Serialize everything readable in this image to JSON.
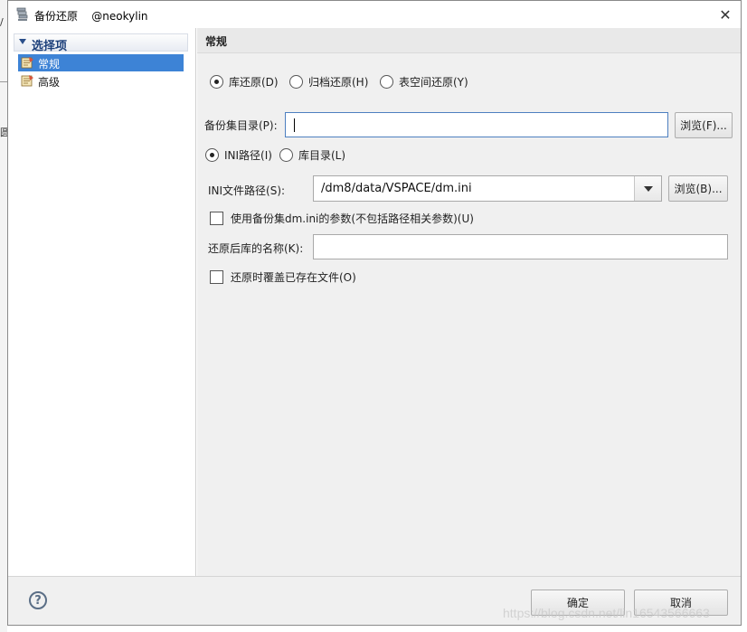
{
  "window": {
    "title": "备份还原",
    "subtitle": "@neokylin",
    "close_glyph": "✕"
  },
  "tree": {
    "header": "选择项",
    "items": [
      {
        "label": "常规",
        "selected": true
      },
      {
        "label": "高级",
        "selected": false
      }
    ]
  },
  "section": {
    "title": "常规"
  },
  "restore_type": {
    "options": [
      {
        "label": "库还原(D)",
        "checked": true
      },
      {
        "label": "归档还原(H)",
        "checked": false
      },
      {
        "label": "表空间还原(Y)",
        "checked": false
      }
    ]
  },
  "backup_dir": {
    "label": "备份集目录(P):",
    "value": "",
    "browse_label": "浏览(F)..."
  },
  "path_mode": {
    "options": [
      {
        "label": "INI路径(I)",
        "checked": true
      },
      {
        "label": "库目录(L)",
        "checked": false
      }
    ]
  },
  "ini_path": {
    "label": "INI文件路径(S):",
    "value": "/dm8/data/VSPACE/dm.ini",
    "browse_label": "浏览(B)..."
  },
  "use_backup_ini": {
    "label": "使用备份集dm.ini的参数(不包括路径相关参数)(U)",
    "checked": false
  },
  "restored_db_name": {
    "label": "还原后库的名称(K):",
    "value": ""
  },
  "overwrite_files": {
    "label": "还原时覆盖已存在文件(O)",
    "checked": false
  },
  "footer": {
    "help_glyph": "?",
    "ok_label": "确定",
    "cancel_label": "取消"
  },
  "background": {
    "glyph_top": "/",
    "glyph_mid": "圆"
  },
  "watermark": "https://blog.csdn.net/lin16543566663",
  "colors": {
    "selection": "#3d83d6",
    "panel": "#f0f0f0",
    "tree_header_text": "#1c3f7a"
  }
}
